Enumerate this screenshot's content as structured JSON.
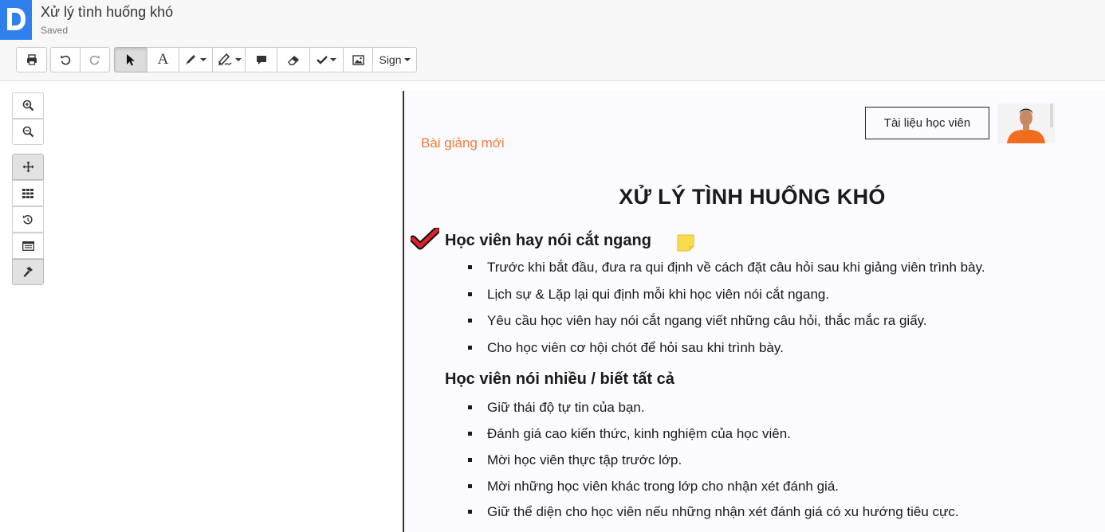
{
  "app": {
    "title": "Xử lý tình huống khó",
    "status": "Saved",
    "logo_letter": "D"
  },
  "toolbar": {
    "print_icon": "printer-icon",
    "undo_icon": "undo-icon",
    "redo_icon": "redo-icon",
    "select_icon": "cursor-arrow-icon",
    "text_label": "A",
    "draw_icon": "pencil-icon",
    "highlight_icon": "highlighter-icon",
    "comment_icon": "comment-icon",
    "eraser_icon": "eraser-icon",
    "check_icon": "check-icon",
    "image_icon": "image-icon",
    "sign_label": "Sign"
  },
  "side_tools": {
    "zoom_in_icon": "zoom-in-icon",
    "zoom_out_icon": "zoom-out-icon",
    "pan_icon": "move-icon",
    "grid_icon": "thumbnails-grid-icon",
    "history_icon": "history-icon",
    "outline_icon": "outline-list-icon",
    "hammer_icon": "hammer-icon"
  },
  "document": {
    "tag": "Bài giảng mới",
    "student_box": "Tài liệu học viên",
    "heading": "XỬ LÝ TÌNH HUỐNG KHÓ",
    "sections": [
      {
        "title": "Học viên hay nói cắt ngang",
        "bullets": [
          "Trước khi bắt đầu, đưa ra qui định về cách đặt câu hỏi sau khi giảng viên trình bày.",
          "Lịch sự & Lặp lại qui định mỗi khi học viên nói cắt ngang.",
          "Yêu cầu học viên hay nói cắt ngang viết những câu hỏi, thắc mắc ra giấy.",
          "Cho học viên cơ hội chót để hỏi sau khi trình bày."
        ]
      },
      {
        "title": "Học viên nói nhiều / biết tất cả",
        "bullets": [
          "Giữ thái độ tự tin của bạn.",
          "Đánh giá cao kiến thức, kinh nghiệm của học viên.",
          "Mời học viên thực tập trước lớp.",
          "Mời những học viên khác trong lớp cho nhận xét đánh giá.",
          "Giữ thể diện cho học viên nếu những nhận xét đánh giá có xu hướng tiêu cực."
        ]
      }
    ]
  },
  "colors": {
    "brand": "#2f80ed",
    "accent_orange": "#f07a36",
    "check_red": "#e0202a",
    "sticky_yellow": "#f7dc4b"
  }
}
